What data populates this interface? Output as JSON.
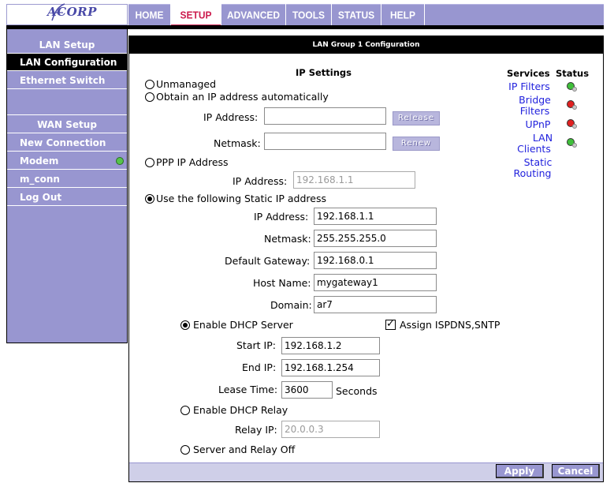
{
  "logo": {
    "text": "ACORP"
  },
  "nav": {
    "tabs": [
      {
        "label": "HOME"
      },
      {
        "label": "SETUP",
        "active": true
      },
      {
        "label": "ADVANCED"
      },
      {
        "label": "TOOLS"
      },
      {
        "label": "STATUS"
      },
      {
        "label": "HELP"
      }
    ]
  },
  "sidebar": {
    "lan_setup_header": "LAN Setup",
    "lan_configuration": "LAN Configuration",
    "ethernet_switch": "Ethernet Switch",
    "wan_setup_header": "WAN Setup",
    "new_connection": "New Connection",
    "modem": "Modem",
    "m_conn": "m_conn",
    "log_out": "Log Out"
  },
  "main": {
    "title": "LAN Group 1 Configuration",
    "ip_settings_header": "IP Settings",
    "unmanaged_label": "Unmanaged",
    "obtain_auto_label": "Obtain an IP address automatically",
    "auto_ip_label": "IP Address:",
    "auto_ip_value": "",
    "release_label": "Release",
    "auto_netmask_label": "Netmask:",
    "auto_netmask_value": "",
    "renew_label": "Renew",
    "ppp_label": "PPP IP Address",
    "ppp_ip_label": "IP Address:",
    "ppp_ip_value": "192.168.1.1",
    "static_label": "Use the following Static IP address",
    "static": {
      "ip_label": "IP Address:",
      "ip_value": "192.168.1.1",
      "netmask_label": "Netmask:",
      "netmask_value": "255.255.255.0",
      "gateway_label": "Default Gateway:",
      "gateway_value": "192.168.0.1",
      "host_label": "Host Name:",
      "host_value": "mygateway1",
      "domain_label": "Domain:",
      "domain_value": "ar7"
    },
    "dhcp": {
      "enable_server_label": "Enable DHCP Server",
      "assign_label": "Assign ISPDNS,SNTP",
      "start_label": "Start IP:",
      "start_value": "192.168.1.2",
      "end_label": "End IP:",
      "end_value": "192.168.1.254",
      "lease_label": "Lease Time:",
      "lease_value": "3600",
      "seconds_label": "Seconds",
      "relay_label": "Enable DHCP Relay",
      "relay_ip_label": "Relay IP:",
      "relay_ip_value": "20.0.0.3",
      "off_label": "Server and Relay Off"
    },
    "services_header": "Services",
    "status_header": "Status",
    "services": {
      "ip_filters": "IP Filters",
      "bridge": "Bridge",
      "filters": "Filters",
      "upnp": "UPnP",
      "lan": "LAN",
      "clients": "Clients",
      "static": "Static",
      "routing": "Routing"
    },
    "status_colors": {
      "ip_filters": "#3fbf3a",
      "bridge_filters": "#e02020",
      "upnp": "#e02020",
      "lan_clients": "#3fbf3a"
    }
  },
  "footer": {
    "apply_label": "Apply",
    "cancel_label": "Cancel"
  }
}
